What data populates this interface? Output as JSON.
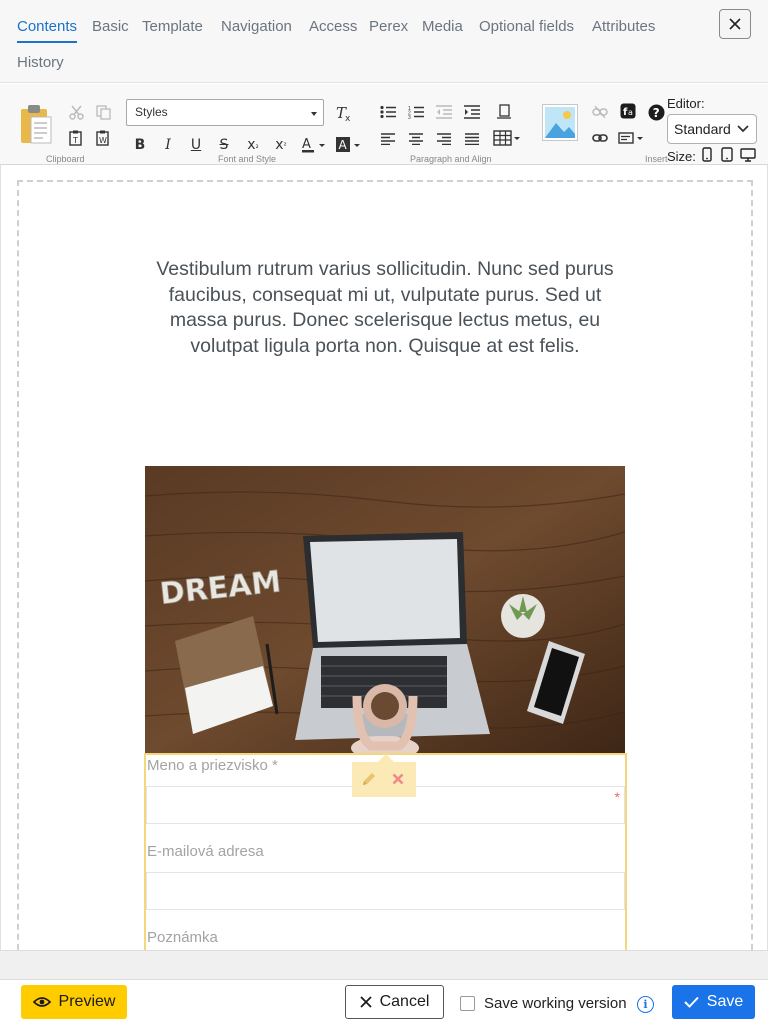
{
  "tabs": [
    {
      "label": "Contents"
    },
    {
      "label": "Basic"
    },
    {
      "label": "Template"
    },
    {
      "label": "Navigation"
    },
    {
      "label": "Access"
    },
    {
      "label": "Perex"
    },
    {
      "label": "Media"
    },
    {
      "label": "Optional fields"
    },
    {
      "label": "Attributes"
    },
    {
      "label": "History"
    }
  ],
  "active_tab": "Contents",
  "toolbar": {
    "styles_value": "Styles",
    "groups": {
      "clipboard": "Clipboard",
      "font_style": "Font and Style",
      "paragraph_align": "Paragraph and Align",
      "insert": "Insert"
    },
    "editor_label": "Editor:",
    "editor_value": "Standard",
    "size_label": "Size:",
    "icons": [
      "paste-icon",
      "cut-icon",
      "copy-icon",
      "paste-text-icon",
      "paste-word-icon",
      "remove-format-icon",
      "bold-icon",
      "italic-icon",
      "underline-icon",
      "strikethrough-icon",
      "subscript-icon",
      "superscript-icon",
      "text-color-icon",
      "background-color-icon",
      "bulleted-list-icon",
      "numbered-list-icon",
      "outdent-icon",
      "indent-icon",
      "div-icon",
      "align-left-icon",
      "align-center-icon",
      "align-right-icon",
      "justify-icon",
      "table-icon",
      "image-icon",
      "unlink-icon",
      "link-icon",
      "font-awesome-icon",
      "help-icon",
      "form-icon",
      "mobile-size-icon",
      "tablet-size-icon",
      "desktop-size-icon"
    ]
  },
  "content": {
    "lead_text": "Vestibulum rutrum varius sollicitudin. Nunc sed purus faucibus, consequat mi ut, vulputate purus. Sed ut massa purus. Donec scelerisque lectus metus, eu volutpat ligula porta non. Quisque at est felis.",
    "image_text": "DREAM",
    "form": {
      "fields": [
        {
          "label": "Meno a priezvisko *",
          "required": true
        },
        {
          "label": "E-mailová adresa",
          "required": false
        },
        {
          "label": "Poznámka",
          "required": false
        }
      ],
      "required_mark": "*"
    }
  },
  "footer": {
    "preview_label": "Preview",
    "cancel_label": "Cancel",
    "save_working_label": "Save working version",
    "save_working_checked": false,
    "save_label": "Save"
  },
  "colors": {
    "accent": "#1a73c8",
    "save_button": "#1a73e8",
    "preview_button": "#ffcc00",
    "form_highlight": "#f5d67a",
    "toolbar_bg": "#f8f8f8"
  }
}
